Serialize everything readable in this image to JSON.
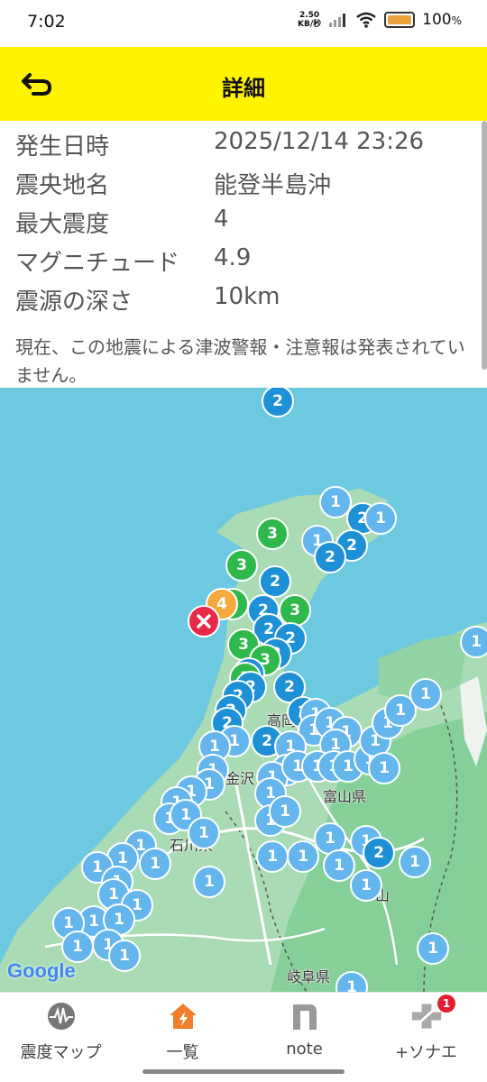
{
  "status_bar": {
    "time": "7:02",
    "speed_value": "2.50",
    "speed_unit": "KB/秒",
    "battery": "100",
    "battery_unit": "%"
  },
  "header": {
    "title": "詳細",
    "back_icon": "undo-arrow-icon",
    "bg_color": "#fff300"
  },
  "details": {
    "rows": [
      {
        "label": "発生日時",
        "value": "2025/12/14 23:26"
      },
      {
        "label": "震央地名",
        "value": "能登半島沖"
      },
      {
        "label": "最大震度",
        "value": "4"
      },
      {
        "label": "マグニチュード",
        "value": "4.9"
      },
      {
        "label": "震源の深さ",
        "value": "10km"
      }
    ],
    "notice": "現在、この地震による津波警報・注意報は発表されていません。"
  },
  "map": {
    "labels": [
      "高岡",
      "金沢",
      "富山県",
      "石川県",
      "山",
      "岐阜県"
    ],
    "google": "Google",
    "intensity_colors": {
      "1": "#66b6ee",
      "2": "#1e90d6",
      "3": "#2fb94c",
      "4": "#f3a93e"
    },
    "epicenter_icon": "epicenter-x-icon"
  },
  "bottom_nav": {
    "items": [
      {
        "label": "震度マップ",
        "icon": "seismograph-icon"
      },
      {
        "label": "一覧",
        "icon": "house-alert-icon"
      },
      {
        "label": "note",
        "icon": "note-n-icon"
      },
      {
        "label": "+ソナエ",
        "icon": "plus-sonae-icon",
        "badge": "1"
      }
    ]
  }
}
